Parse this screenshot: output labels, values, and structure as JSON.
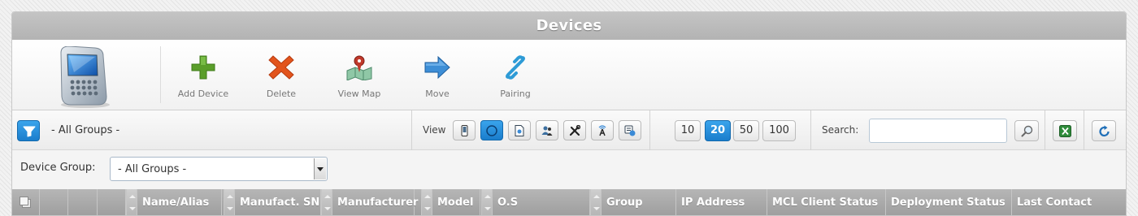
{
  "window": {
    "title": "Devices"
  },
  "toolbar": {
    "icon": "smartphone-icon",
    "buttons": [
      {
        "label": "Add Device",
        "icon": "plus-icon",
        "color": "#5a9e2a"
      },
      {
        "label": "Delete",
        "icon": "delete-x-icon",
        "color": "#e2541c"
      },
      {
        "label": "View Map",
        "icon": "map-icon",
        "color": "#c0392b"
      },
      {
        "label": "Move",
        "icon": "arrow-right-icon",
        "color": "#3d8ed6"
      },
      {
        "label": "Pairing",
        "icon": "link-icon",
        "color": "#2e9bd6"
      }
    ]
  },
  "filterbar": {
    "group_label": "- All Groups -",
    "view_label": "View",
    "view_modes": [
      {
        "icon": "phone-icon"
      },
      {
        "icon": "circle-icon",
        "active": true
      },
      {
        "icon": "document-icon"
      },
      {
        "icon": "users-icon"
      },
      {
        "icon": "tools-icon"
      },
      {
        "icon": "antenna-icon"
      },
      {
        "icon": "devices-list-icon"
      }
    ],
    "page_sizes": [
      "10",
      "20",
      "50",
      "100"
    ],
    "active_page_size": "20",
    "search_label": "Search:",
    "search_value": "",
    "accent": "#1f88d9"
  },
  "groupbar": {
    "label": "Device Group:",
    "selected": "- All Groups -"
  },
  "table": {
    "columns": [
      "Name/Alias",
      "Manufact. SN",
      "Manufacturer",
      "Model",
      "O.S",
      "Group",
      "IP Address",
      "MCL Client Status",
      "Deployment Status",
      "Last Contact"
    ]
  }
}
